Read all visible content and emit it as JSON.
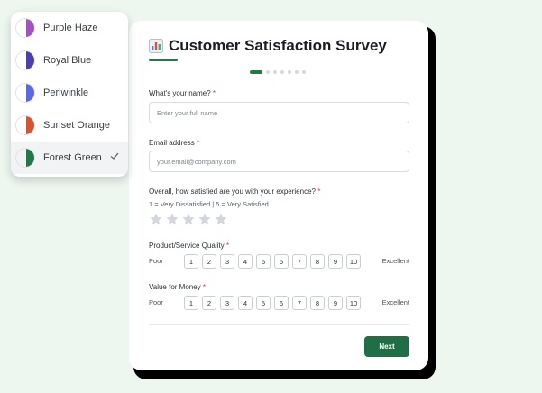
{
  "themes": [
    {
      "label": "Purple Haze",
      "color": "#a74fc4",
      "selected": false
    },
    {
      "label": "Royal Blue",
      "color": "#4a3fb0",
      "selected": false
    },
    {
      "label": "Periwinkle",
      "color": "#5a67e6",
      "selected": false
    },
    {
      "label": "Sunset Orange",
      "color": "#d8552b",
      "selected": false
    },
    {
      "label": "Forest Green",
      "color": "#1f7a48",
      "selected": true
    }
  ],
  "survey": {
    "title": "Customer Satisfaction Survey",
    "progress": {
      "total_steps": 8,
      "current_step": 1
    },
    "name": {
      "label": "What's your name?",
      "required_mark": "*",
      "placeholder": "Enter your full name"
    },
    "email": {
      "label": "Email address",
      "required_mark": "*",
      "placeholder": "your.email@company.com"
    },
    "satisfaction": {
      "label": "Overall, how satisfied are you with your experience?",
      "required_mark": "*",
      "hint": "1 = Very Dissatisfied | 5 = Very Satisfied",
      "max_stars": 5,
      "rating": 0
    },
    "quality": {
      "label": "Product/Service Quality",
      "required_mark": "*",
      "low_label": "Poor",
      "high_label": "Excellent",
      "options": [
        "1",
        "2",
        "3",
        "4",
        "5",
        "6",
        "7",
        "8",
        "9",
        "10"
      ]
    },
    "value": {
      "label": "Value for Money",
      "required_mark": "*",
      "low_label": "Poor",
      "high_label": "Excellent",
      "options": [
        "1",
        "2",
        "3",
        "4",
        "5",
        "6",
        "7",
        "8",
        "9",
        "10"
      ]
    },
    "next_label": "Next"
  },
  "colors": {
    "accent": "#1f7a48",
    "star_empty": "#d3d7dc"
  }
}
